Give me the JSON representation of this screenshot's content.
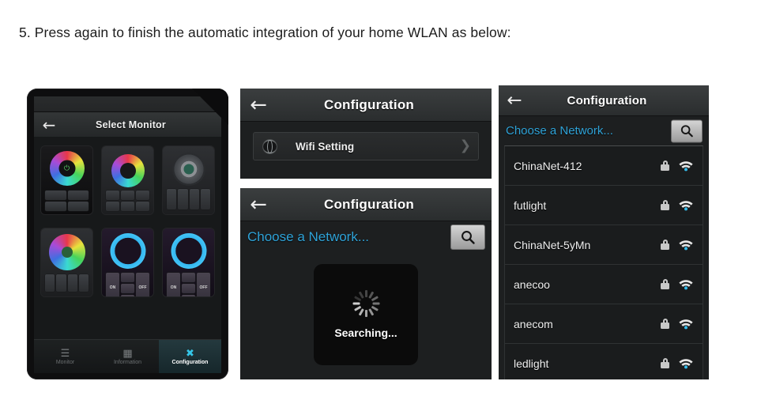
{
  "instruction": "5. Press again to finish the automatic integration of your home WLAN as below:",
  "colors": {
    "accent_blue": "#2fa3d8",
    "wifi_blue": "#35bdec",
    "tab_active": "#35c6e8",
    "panel_bg": "#1d1f20",
    "nav_bg": "#2f3233"
  },
  "panel1": {
    "nav": {
      "back_icon": "back-arrow-icon",
      "title": "Select Monitor"
    },
    "devices": [
      {
        "id": "device-1",
        "style": "dark",
        "control": "rgb-wheel-power"
      },
      {
        "id": "device-2",
        "style": "grey",
        "control": "rgb-wheel-keypad"
      },
      {
        "id": "device-3",
        "style": "grey",
        "control": "dpad-keypad"
      },
      {
        "id": "device-4",
        "style": "grey",
        "control": "rgb-wheel-large"
      },
      {
        "id": "device-5",
        "style": "violet",
        "control": "led-ring-onoff",
        "on_label": "ON",
        "off_label": "OFF"
      },
      {
        "id": "device-6",
        "style": "violet",
        "control": "led-ring-onoff",
        "on_label": "ON",
        "off_label": "OFF"
      }
    ],
    "tabs": [
      {
        "label": "Monitor",
        "icon": "sliders-icon",
        "active": false
      },
      {
        "label": "Information",
        "icon": "server-icon",
        "active": false
      },
      {
        "label": "Configuration",
        "icon": "tools-icon",
        "active": true
      }
    ]
  },
  "panel2": {
    "nav": {
      "back_icon": "back-arrow-icon",
      "title": "Configuration"
    },
    "row": {
      "icon": "globe-icon",
      "label": "Wifi Setting",
      "chevron": "chevron-right-icon"
    }
  },
  "panel3": {
    "nav": {
      "back_icon": "back-arrow-icon",
      "title": "Configuration"
    },
    "choose": {
      "title": "Choose a Network...",
      "search_icon": "search-icon"
    },
    "overlay": {
      "spinner": "spinner-icon",
      "text": "Searching..."
    }
  },
  "panel4": {
    "nav": {
      "back_icon": "back-arrow-icon",
      "title": "Configuration"
    },
    "choose": {
      "title": "Choose a Network...",
      "search_icon": "search-icon"
    },
    "networks": [
      {
        "ssid": "ChinaNet-412",
        "secured": true,
        "signal": "wifi-full-icon"
      },
      {
        "ssid": "futlight",
        "secured": true,
        "signal": "wifi-full-icon"
      },
      {
        "ssid": "ChinaNet-5yMn",
        "secured": true,
        "signal": "wifi-full-icon"
      },
      {
        "ssid": "anecoo",
        "secured": true,
        "signal": "wifi-full-icon"
      },
      {
        "ssid": "anecom",
        "secured": true,
        "signal": "wifi-full-icon"
      },
      {
        "ssid": "ledlight",
        "secured": true,
        "signal": "wifi-full-icon"
      }
    ]
  }
}
